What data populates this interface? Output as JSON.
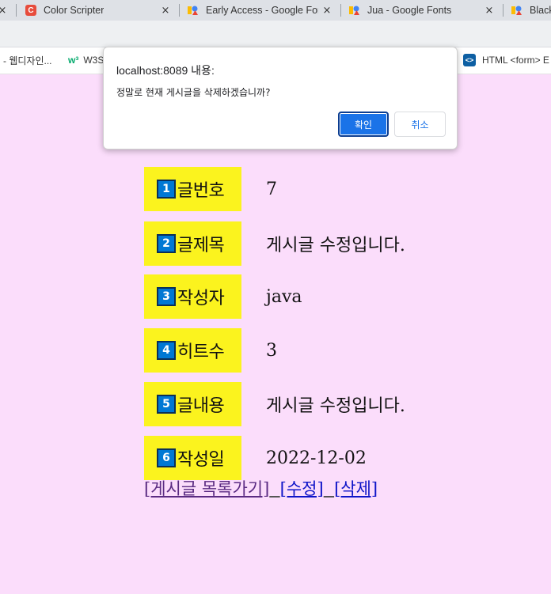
{
  "browser": {
    "tabs": [
      {
        "title": "",
        "icon": "tab-edge-icon"
      },
      {
        "title": "Color Scripter",
        "icon": "color-scripter-icon",
        "icon_color": "#e74c3c",
        "icon_letter": "C"
      },
      {
        "title": "Early Access - Google For",
        "icon": "google-fonts-icon"
      },
      {
        "title": "Jua - Google Fonts",
        "icon": "google-fonts-icon"
      },
      {
        "title": "Black",
        "icon": "google-fonts-icon"
      }
    ],
    "close_glyph": "×",
    "bookmarks": [
      {
        "label": "- 웹디자인...",
        "icon": ""
      },
      {
        "label": "W3S",
        "icon": "w3schools-icon",
        "icon_text": "w³"
      },
      {
        "label": "HTML <form> E",
        "icon": "code-icon",
        "icon_text": "<>"
      }
    ]
  },
  "dialog": {
    "title": "localhost:8089 내용:",
    "message": "정말로 현재 게시글을 삭제하겠습니까?",
    "ok_label": "확인",
    "cancel_label": "취소",
    "primary_color": "#1a73e8"
  },
  "post": {
    "fields": [
      {
        "num": "1",
        "label": "글번호",
        "value": "7"
      },
      {
        "num": "2",
        "label": "글제목",
        "value": "게시글 수정입니다."
      },
      {
        "num": "3",
        "label": "작성자",
        "value": "java"
      },
      {
        "num": "4",
        "label": "히트수",
        "value": "3"
      },
      {
        "num": "5",
        "label": "글내용",
        "value": "게시글 수정입니다."
      },
      {
        "num": "6",
        "label": "작성일",
        "value": "2022-12-02"
      }
    ],
    "label_bg": "#fbf31e",
    "badge_color": "#0078d4",
    "page_bg": "#fbddfb"
  },
  "links": {
    "list_label": "[게시글 목록가기]",
    "edit_label": "[수정]",
    "delete_label": "[삭제]"
  }
}
